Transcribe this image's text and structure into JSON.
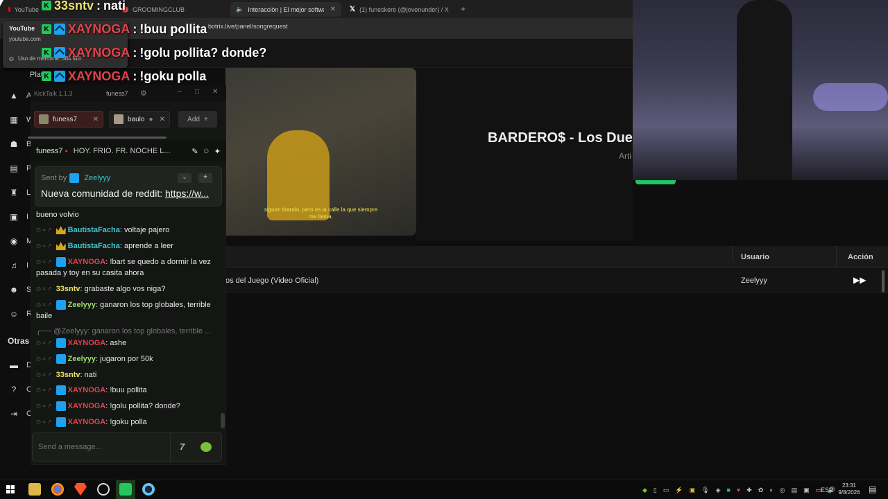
{
  "browser": {
    "tabs": [
      {
        "label": "YouTube",
        "color": "#ff0000"
      },
      {
        "label": "GROOMINGCLUB",
        "color": "#e5414b"
      },
      {
        "label": "Interacción | El mejor softwa",
        "color": "#cccccc"
      },
      {
        "label": "(1) funeskere (@jovenunder) / X",
        "color": "#ffffff"
      }
    ],
    "new_tab": "+",
    "url": "botrix.live/panel/songrequest",
    "hover_card": {
      "title": "YouTube",
      "domain": "youtube.com",
      "memory": "Uso de memoria: 384 MB"
    }
  },
  "sidebar": {
    "items": [
      {
        "icon": "warning-icon",
        "label": "A"
      },
      {
        "icon": "windows-icon",
        "label": "W"
      },
      {
        "icon": "robot-icon",
        "label": "B"
      },
      {
        "icon": "id-card-icon",
        "label": "P"
      },
      {
        "icon": "trophy-icon",
        "label": "L"
      },
      {
        "icon": "info-icon",
        "label": "I"
      },
      {
        "icon": "gamepad-icon",
        "label": "M"
      },
      {
        "icon": "music-icon",
        "label": "I"
      },
      {
        "icon": "users-icon",
        "label": "S"
      },
      {
        "icon": "user-icon",
        "label": "R"
      }
    ],
    "section": "Otras",
    "bottom_items": [
      {
        "icon": "doc-icon",
        "label": "D"
      },
      {
        "icon": "help-icon",
        "label": "C"
      },
      {
        "icon": "logout-icon",
        "label": "C"
      }
    ],
    "partial_label": "Plat"
  },
  "overlay_chat": [
    {
      "user": "33sntv",
      "message": "nati",
      "style": "yellow"
    },
    {
      "user": "XAYNOGA",
      "message": "!buu pollita",
      "style": "red"
    },
    {
      "user": "XAYNOGA",
      "message": "!golu pollita? donde?",
      "style": "red"
    },
    {
      "user": "XAYNOGA",
      "message": "!goku polla",
      "style": "red"
    }
  ],
  "video": {
    "subtitle_line1": "siguen tirando, pero es la calle la que siempre",
    "subtitle_line2": "me llama."
  },
  "song": {
    "title": "BARDERO$ - Los Dueñ",
    "artist_partial": "Arti"
  },
  "table": {
    "headers": {
      "user": "Usuario",
      "action": "Acción"
    },
    "rows": [
      {
        "song": "os del Juego (Video Oficial)",
        "user": "Zeelyyy",
        "action_icon": "skip-forward-icon"
      }
    ]
  },
  "kicktalk": {
    "app_title": "KickTalk 1.1.3",
    "current_user": "funess7",
    "tabs": [
      {
        "label": "funess7",
        "active": true
      },
      {
        "label": "baulo",
        "active": false
      }
    ],
    "add_label": "Add",
    "stream_channel": "funess7",
    "stream_title": "HOY. FRIO. FR. NOCHE L...",
    "pinned": {
      "sent_by_label": "Sent by",
      "sent_by_user": "Zeelyyy",
      "text": "Nueva comunidad de reddit: ",
      "link": "https://w..."
    },
    "messages": [
      {
        "type": "text",
        "text": "bueno volvio"
      },
      {
        "user": "BautistaFacha",
        "color": "cyan",
        "badge": "crown",
        "text": "voltaje pajero"
      },
      {
        "user": "BautistaFacha",
        "color": "cyan",
        "badge": "crown",
        "text": "aprende a leer"
      },
      {
        "user": "XAYNOGA",
        "color": "red",
        "badge": "blue",
        "text": "!bart se quedo a dormir la vez pasada y toy en su casita ahora"
      },
      {
        "user": "33sntv",
        "color": "yellow",
        "badge": "",
        "text": "grabaste algo vos niga?"
      },
      {
        "user": "Zeelyyy",
        "color": "green",
        "badge": "blue",
        "text": "ganaron los top globales, terrible baile"
      },
      {
        "type": "reply",
        "text": "@Zeelyyy: ganaron los top globales, terrible ..."
      },
      {
        "user": "XAYNOGA",
        "color": "red",
        "badge": "blue",
        "text": "ashe"
      },
      {
        "user": "Zeelyyy",
        "color": "green",
        "badge": "blue",
        "text": "jugaron por 50k"
      },
      {
        "user": "33sntv",
        "color": "yellow",
        "badge": "",
        "text": "nati"
      },
      {
        "user": "XAYNOGA",
        "color": "red",
        "badge": "blue",
        "text": "!buu pollita"
      },
      {
        "user": "XAYNOGA",
        "color": "red",
        "badge": "blue",
        "text": "!golu pollita? donde?"
      },
      {
        "user": "XAYNOGA",
        "color": "red",
        "badge": "blue",
        "text": "!goku polla"
      }
    ],
    "input_placeholder": "Send a message..."
  },
  "taskbar": {
    "lang": "ESP",
    "time": "23:31",
    "date": "9/8/2026"
  }
}
